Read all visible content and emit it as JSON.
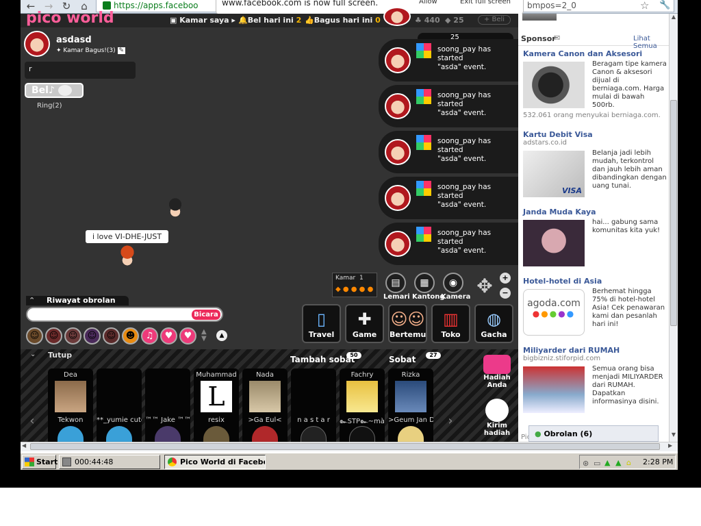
{
  "browser": {
    "url": "https://apps.faceboo",
    "url_tail": "bmpos=2_0",
    "fullscreen_notice": "www.facebook.com is now full screen.",
    "allow_label": "Allow",
    "exit_label": "Exit full screen"
  },
  "game": {
    "logo": "pico world",
    "stats": {
      "kamar_saya": "Kamar saya",
      "bel_hari_ini_label": "Bel hari ini",
      "bel_hari_ini_value": "2",
      "bagus_hari_ini_label": "Bagus hari ini",
      "bagus_hari_ini_value": "0",
      "coins": "440",
      "diamonds": "25",
      "beli": "+ Beli",
      "counter": "25"
    },
    "user": {
      "name": "asdasd",
      "room_label": "Kamar Bagus!(3)",
      "chat_text": "r",
      "bel_label": "Bel",
      "ring_text": "Ring(2)"
    },
    "events": [
      {
        "line1": "soong_pay has started",
        "line2": "\"asda\" event."
      },
      {
        "line1": "soong_pay has started",
        "line2": "\"asda\" event."
      },
      {
        "line1": "soong_pay has started",
        "line2": "\"asda\" event."
      },
      {
        "line1": "soong_pay has started",
        "line2": "\"asda\" event."
      },
      {
        "line1": "soong_pay has started",
        "line2": "\"asda\" event."
      }
    ],
    "speech_bubble": "i love   VI-DHE-JUST",
    "kamar_label": "Kamar",
    "kamar_value": "1",
    "buttons": {
      "lemari": "Lemari",
      "kantong": "Kantong",
      "kamera": "Kamera",
      "travel": "Travel",
      "game": "Game",
      "bertemu": "Bertemu",
      "toko": "Toko",
      "gacha": "Gacha"
    },
    "chat_history": "Riwayat obrolan",
    "bicara": "Bicara"
  },
  "friends": {
    "tutup": "Tutup",
    "tambah_sobat": "Tambah sobat",
    "tambah_count": "50",
    "sobat": "Sobat",
    "sobat_count": "27",
    "cards": [
      {
        "top": "Dea",
        "bottom": "Tekwon"
      },
      {
        "top": "",
        "bottom": "**_yumie cute"
      },
      {
        "top": "",
        "bottom": "™™ Jake ™™"
      },
      {
        "top": "Muhammad",
        "bottom": "resix"
      },
      {
        "top": "Nada",
        "bottom": ">Ga Eul<"
      },
      {
        "top": "",
        "bottom": "n a s t a r"
      },
      {
        "top": "Fachry",
        "bottom": "๛STP๛~mà★"
      },
      {
        "top": "Rizka",
        "bottom": ">Geum Jan Di"
      }
    ],
    "hadiah_anda": "Hadiah Anda",
    "kirim_hadiah": "Kirim hadiah"
  },
  "sidebar": {
    "sponsor": "Sponsor",
    "lihat_semua": "Lihat Semua",
    "ads": [
      {
        "title": "Kamera Canon dan Aksesori",
        "sub": "",
        "text": "Beragam tipe kamera Canon & aksesori dijual di berniaga.com. Harga mulai di bawah 500rb.",
        "footer": "532.061 orang menyukai berniaga.com."
      },
      {
        "title": "Kartu Debit Visa",
        "sub": "adstars.co.id",
        "text": "Belanja jadi lebih mudah, terkontrol dan jauh lebih aman dibandingkan dengan uang tunai.",
        "footer": ""
      },
      {
        "title": "Janda Muda Kaya",
        "sub": "",
        "text": "hai... gabung sama komunitas kita yuk!",
        "footer": ""
      },
      {
        "title": "Hotel-hotel di Asia",
        "sub": "",
        "text": "Berhemat hingga 75% di hotel-hotel Asia! Cek penawaran kami dan pesanlah hari ini!",
        "footer": "",
        "logo": "agoda.com"
      },
      {
        "title": "Miliyarder dari RUMAH",
        "sub": "bigbizniz.stiforpid.com",
        "text": "Semua orang bisa menjadi MILIYARDER dari RUMAH. Dapatkan informasinya disini.",
        "footer": ""
      }
    ],
    "obrolan": "Obrolan (6)",
    "pic_label": "Pic"
  },
  "taskbar": {
    "start": "Start",
    "timer": "000:44:48",
    "active_task": "Pico World di Faceboo...",
    "clock": "2:28 PM"
  },
  "colors": {
    "game_bg": "#333333",
    "accent_pink": "#ec2a5b",
    "fb_blue": "#3b5998"
  }
}
